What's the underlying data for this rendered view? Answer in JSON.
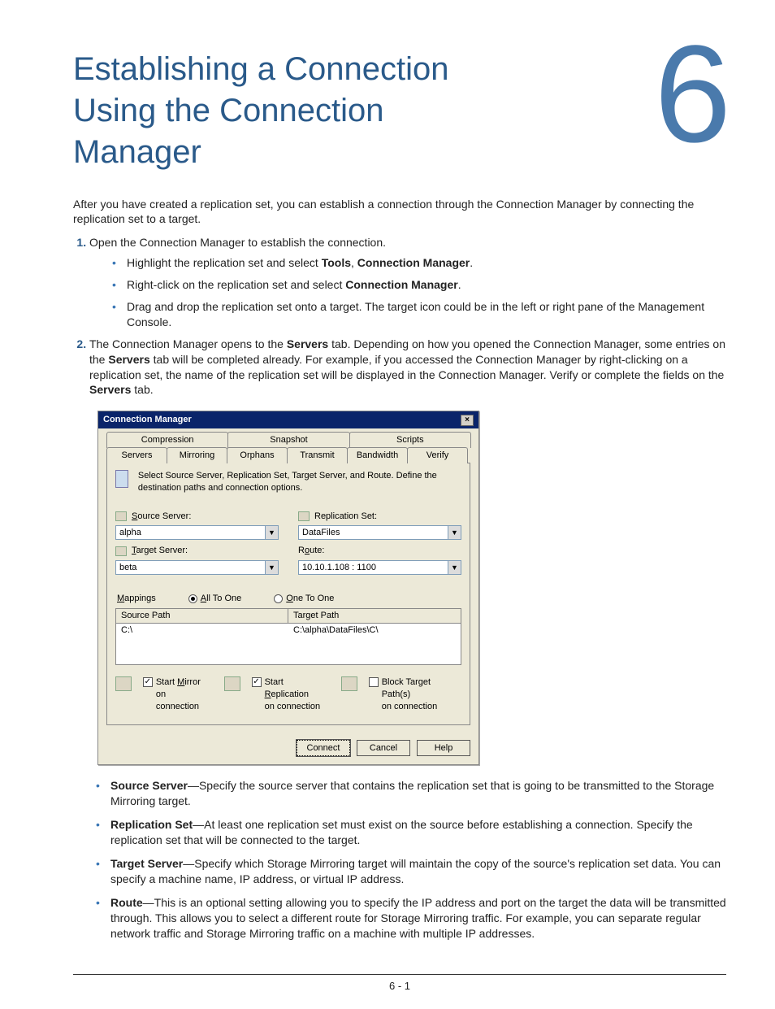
{
  "chapter_number": "6",
  "title": "Establishing a Connection Using the Connection Manager",
  "intro": "After you have created a replication set, you can establish a connection through the Connection Manager by connecting the replication set to a target.",
  "steps": {
    "s1": {
      "text": "Open the Connection Manager to establish the connection.",
      "sub": [
        {
          "pre": "Highlight the replication set and select ",
          "b1": "Tools",
          "mid": ", ",
          "b2": "Connection Manager",
          "post": "."
        },
        {
          "pre": "Right-click on the replication set and select ",
          "b1": "Connection Manager",
          "mid": "",
          "b2": "",
          "post": "."
        },
        {
          "pre": "Drag and drop the replication set onto a target. The target icon could be in the left or right pane of the Management Console.",
          "b1": "",
          "mid": "",
          "b2": "",
          "post": ""
        }
      ]
    },
    "s2": {
      "p1": "The Connection Manager opens to the ",
      "b1": "Servers",
      "p2": " tab. Depending on how you opened the Connection Manager, some entries on the ",
      "b2": "Servers",
      "p3": " tab will be completed already. For example, if you accessed the Connection Manager by right-clicking on a replication set, the name of the replication set will be displayed in the Connection Manager. Verify or complete the fields on the ",
      "b3": "Servers",
      "p4": " tab."
    }
  },
  "dialog": {
    "title": "Connection Manager",
    "tabs_top": [
      "Compression",
      "Snapshot",
      "Scripts"
    ],
    "tabs_bottom": [
      "Servers",
      "Mirroring",
      "Orphans",
      "Transmit",
      "Bandwidth",
      "Verify"
    ],
    "hint": "Select Source Server, Replication Set, Target Server, and Route.  Define the destination paths and connection options.",
    "labels": {
      "source_server": "Source Server:",
      "replication_set": "Replication Set:",
      "target_server": "Target Server:",
      "route": "Route:",
      "mappings": "Mappings",
      "all_to_one": "All To One",
      "one_to_one": "One To One",
      "source_path": "Source Path",
      "target_path": "Target Path"
    },
    "values": {
      "source_server": "alpha",
      "replication_set": "DataFiles",
      "target_server": "beta",
      "route": "10.10.1.108 : 1100",
      "row_source": "C:\\",
      "row_target": "C:\\alpha\\DataFiles\\C\\"
    },
    "checks": {
      "mirror": "Start Mirror on connection",
      "replication": "Start Replication on connection",
      "block": "Block Target Path(s) on connection"
    },
    "buttons": {
      "connect": "Connect",
      "cancel": "Cancel",
      "help": "Help"
    }
  },
  "fields": [
    {
      "name": "Source Server",
      "desc": "—Specify the source server that contains the replication set that is going to be transmitted to the Storage Mirroring target."
    },
    {
      "name": "Replication Set",
      "desc": "—At least one replication set must exist on the source before establishing a connection. Specify the replication set that will be connected to the target."
    },
    {
      "name": "Target Server",
      "desc": "—Specify which Storage Mirroring target will maintain the copy of the source's replication set data. You can specify a machine name, IP address, or virtual IP address."
    },
    {
      "name": "Route",
      "desc": "—This is an optional setting allowing you to specify the IP address and port on the target the data will be transmitted through. This allows you to select a different route for Storage Mirroring traffic. For example, you can separate regular network traffic and Storage Mirroring traffic on a machine with multiple IP addresses."
    }
  ],
  "footer": "6 - 1"
}
